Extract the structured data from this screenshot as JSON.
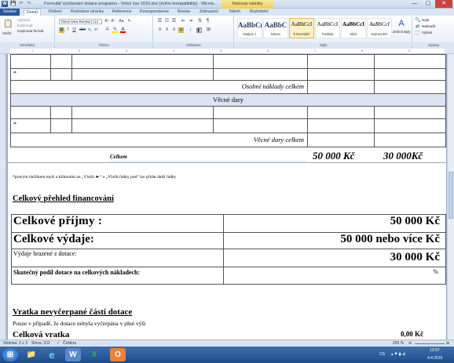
{
  "window": {
    "title": "Formulář vyúčtování dotace programu - Volný čas 2016.doc [režim kompatibility] - Micros...",
    "context_tab_title": "Nástroje tabulky",
    "quick_access": [
      "W",
      "💾",
      "↶",
      "↷"
    ],
    "controls": [
      "—",
      "▢",
      "✕"
    ]
  },
  "ribbon_tabs": [
    "Soubor",
    "Domů",
    "Vložení",
    "Rozložení stránky",
    "Reference",
    "Korespondence",
    "Revize",
    "Zobrazení",
    "Návrh",
    "Rozložení"
  ],
  "clipboard": {
    "paste_label": "Vložit",
    "cut_label": "Vyjmout",
    "copy_label": "Kopírovat",
    "format_painter_label": "Kopírovat formát",
    "group_label": "Schránka"
  },
  "font": {
    "font_name": "Times New Roman",
    "font_size": "14",
    "group_label": "Písmo"
  },
  "paragraph": {
    "group_label": "Odstavec"
  },
  "styles": {
    "items": [
      {
        "preview": "AaBbC(",
        "name": "Nadpis 1"
      },
      {
        "preview": "AaBbC",
        "name": "Název"
      },
      {
        "preview": "AaBbCcI",
        "name": "¶ Normální"
      },
      {
        "preview": "AaBbCcI",
        "name": "Podtitul"
      },
      {
        "preview": "AaBbCcI",
        "name": "Silné"
      },
      {
        "preview": "AaBbCcI",
        "name": "Zvýraznění"
      }
    ],
    "change_styles_label": "Změnit styly",
    "group_label": "Styly"
  },
  "editing": {
    "find_label": "Najít",
    "replace_label": "Nahradit",
    "select_label": "Vybrat",
    "group_label": "Úpravy"
  },
  "document": {
    "bullet_marker": "*",
    "osobni_naklady_label": "Osobní náklady celkem",
    "vecne_dary_header": "Věcné dary",
    "vecne_dary_total_label": "Věcné dary celkem",
    "celkem_label": "Celkem",
    "celkem_amount_1": "50 000 Kč",
    "celkem_amount_2": "30 000Kč",
    "footnote": "*pravým tlačítkem myši a kliknutím na „Vložit ►“ a „Vložit řádky pod“ lze přidat další řádky",
    "overview_heading": "Celkový přehled financování",
    "rows": [
      {
        "label": "Celkové příjmy :",
        "value": "50 000 Kč"
      },
      {
        "label": "Celkové výdaje:",
        "value": "50 000 nebo více Kč"
      },
      {
        "label": "Výdaje hrazené z dotace:",
        "value": "30 000 Kč"
      },
      {
        "label": "Skutečný podíl dotace na celkových nákladech:",
        "value": "%"
      }
    ],
    "refund_heading": "Vratka nevyčerpané části dotace",
    "refund_note": "Pouze v případě, že dotace nebyla vyčerpána v plné výši",
    "cut_off_text": "Celková vratka",
    "cut_off_value": "0,00 Kč"
  },
  "statusbar": {
    "page": "Stránka: 2 z 3",
    "words": "Slova: 222",
    "language": "Čeština",
    "zoom": "200 %"
  },
  "taskbar": {
    "language": "CS",
    "time": "13:07",
    "date": "4.4.2016"
  }
}
